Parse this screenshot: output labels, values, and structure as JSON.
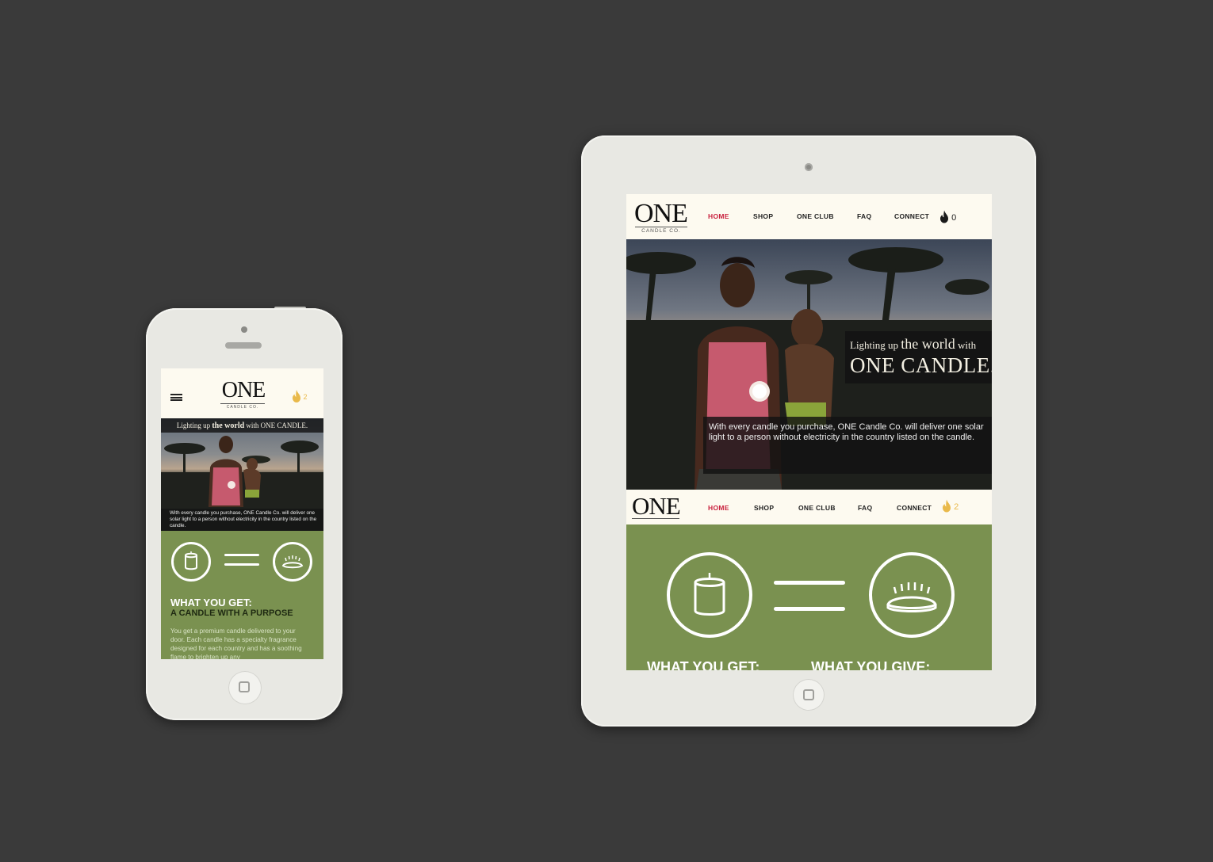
{
  "brand": {
    "logo_text": "ONE",
    "logo_sub": "CANDLE CO."
  },
  "phone": {
    "cart_count": "2",
    "hero": {
      "title_pre": "Lighting up ",
      "title_bold": "the world",
      "title_post": " with ONE CANDLE.",
      "caption": "With every candle you purchase, ONE Candle Co. will deliver one solar light to a person without electricity in the country listed on the candle."
    },
    "what_you_get": "WHAT YOU GET:",
    "candle_purpose": "A CANDLE WITH A PURPOSE",
    "body": "You get a premium candle delivered to your door. Each candle has a specialty fragrance designed for each country and has a soothing flame to brighten up any"
  },
  "tablet": {
    "nav": [
      {
        "label": "HOME",
        "active": true
      },
      {
        "label": "SHOP",
        "active": false
      },
      {
        "label": "ONE CLUB",
        "active": false
      },
      {
        "label": "FAQ",
        "active": false
      },
      {
        "label": "CONNECT",
        "active": false
      }
    ],
    "cart_count": "0",
    "cart_count_2": "2",
    "hero": {
      "title_pre": "Lighting up ",
      "title_mid": "the world",
      "title_post": " with",
      "title_big": "ONE CANDLE.",
      "caption": "With every candle you purchase, ONE Candle Co. will deliver one solar light to a person without electricity in the country listed on the candle."
    },
    "what_you_get": "WHAT YOU GET:",
    "what_you_give": "WHAT YOU GIVE:"
  },
  "colors": {
    "background": "#3a3a3a",
    "cream": "#fdfaf0",
    "green": "#7a9150",
    "accent_red": "#c9223f",
    "flame_yellow": "#e9b94a"
  },
  "icons": [
    "menu-icon",
    "flame-icon",
    "candle-icon",
    "solar-light-icon",
    "equals-icon",
    "home-button-icon"
  ]
}
